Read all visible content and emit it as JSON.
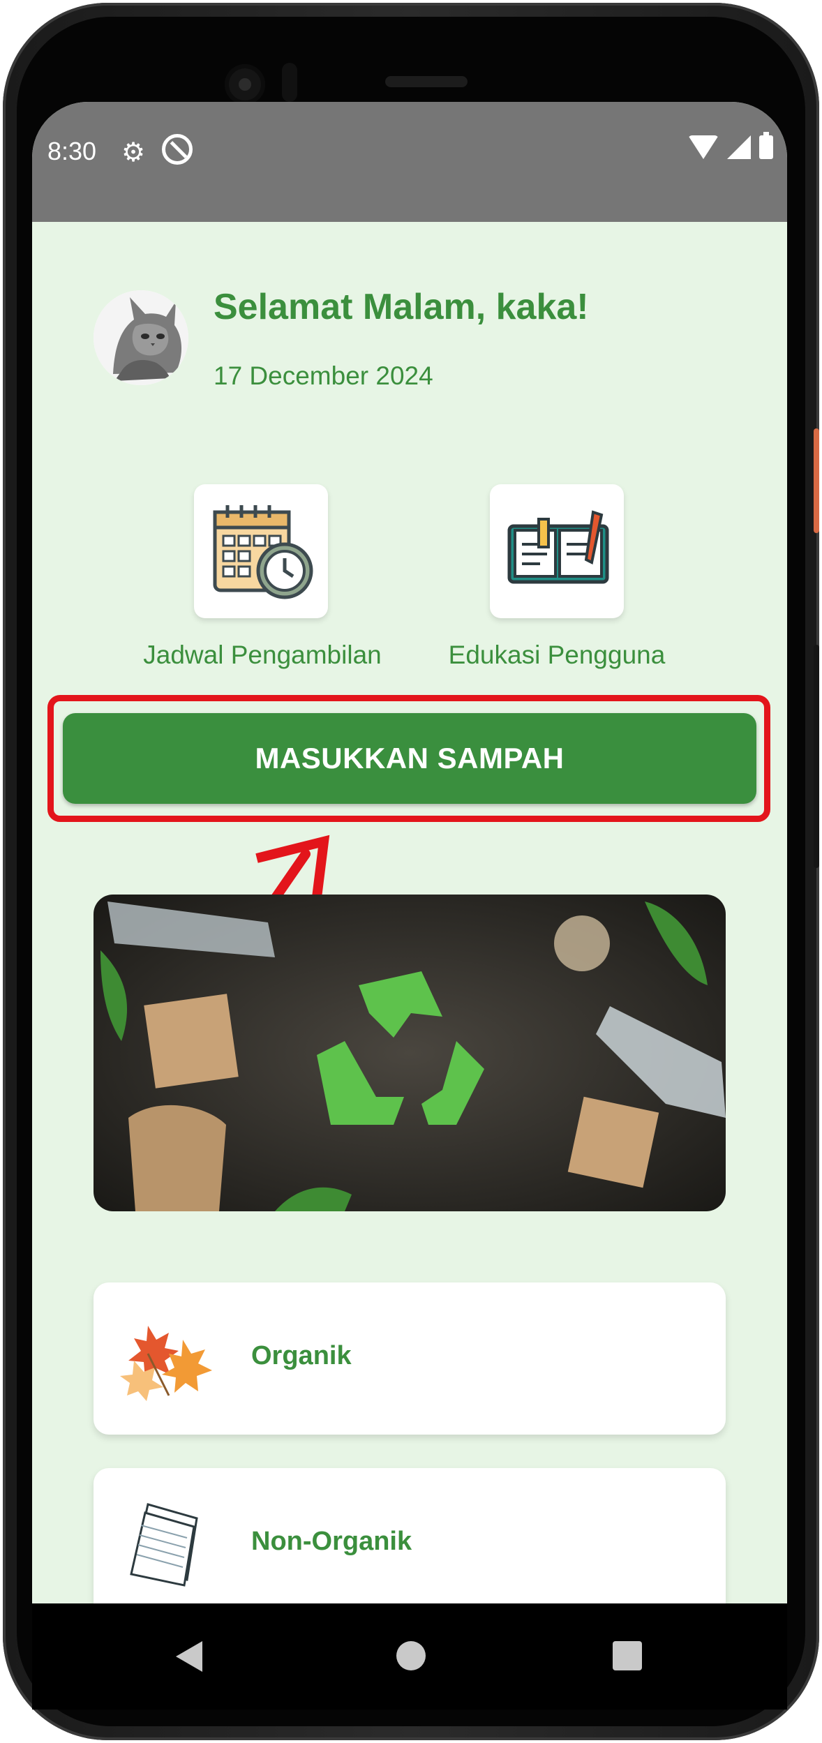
{
  "status_bar": {
    "time": "8:30"
  },
  "header": {
    "greeting": "Selamat Malam, kaka!",
    "date": "17 December 2024"
  },
  "menu": {
    "schedule_label": "Jadwal Pengambilan",
    "education_label": "Edukasi Pengguna"
  },
  "main_button": {
    "label": "MASUKKAN SAMPAH"
  },
  "categories": [
    {
      "label": "Organik"
    },
    {
      "label": "Non-Organik"
    }
  ],
  "colors": {
    "accent_green": "#3a8f3e",
    "background": "#e7f5e5",
    "highlight_red": "#e3151b"
  }
}
